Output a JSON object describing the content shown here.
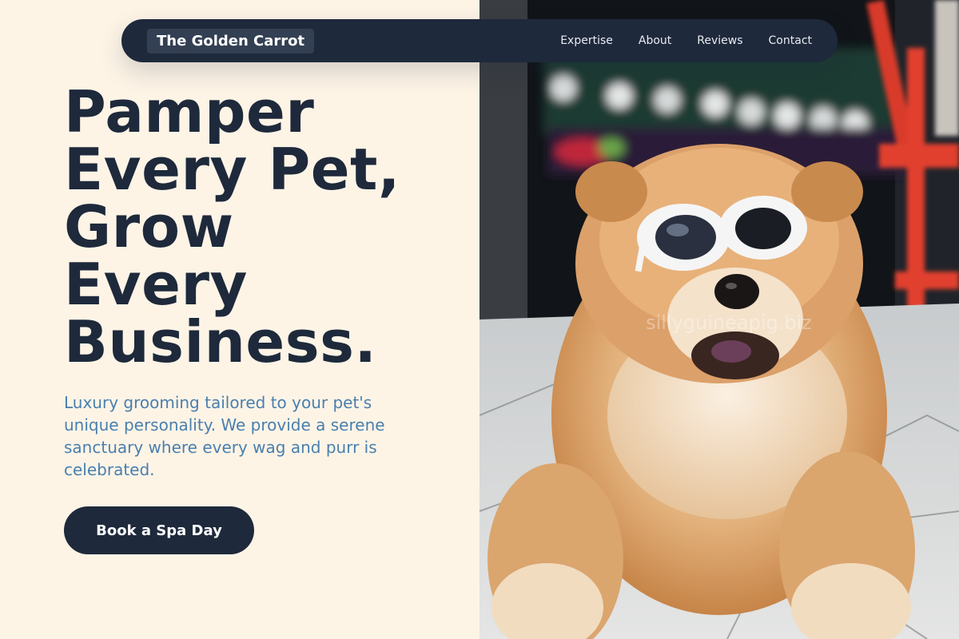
{
  "nav": {
    "brand": "The Golden Carrot",
    "links": [
      "Expertise",
      "About",
      "Reviews",
      "Contact"
    ]
  },
  "hero": {
    "headline_lines": [
      "Pamper",
      "Every Pet,",
      "Grow",
      "Every",
      "Business."
    ],
    "subtext": "Luxury grooming tailored to your pet's unique personality. We provide a serene sanctuary where every wag and purr is celebrated.",
    "cta_label": "Book a Spa Day"
  },
  "photo": {
    "watermark": "sillyguineapig.biz"
  },
  "colors": {
    "navy": "#1e293b",
    "cream": "#fdf4e6",
    "subtext_blue": "#4a7fae",
    "fur": "#d99a5b"
  }
}
